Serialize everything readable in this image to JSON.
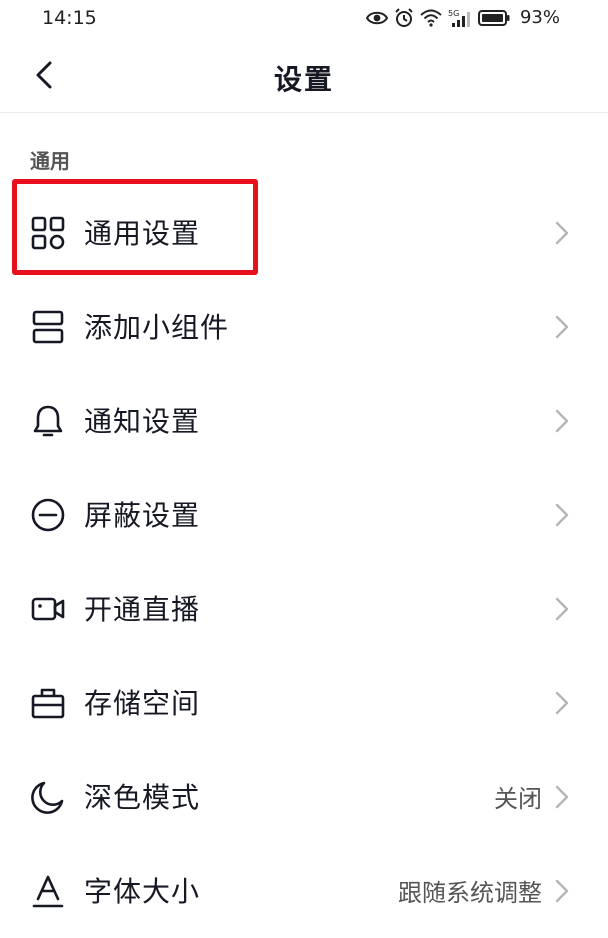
{
  "status_bar": {
    "time": "14:15",
    "battery": "93%"
  },
  "header": {
    "title": "设置"
  },
  "section": {
    "title": "通用"
  },
  "items": [
    {
      "label": "通用设置",
      "value": "",
      "icon": "grid-icon"
    },
    {
      "label": "添加小组件",
      "value": "",
      "icon": "widget-icon"
    },
    {
      "label": "通知设置",
      "value": "",
      "icon": "bell-icon"
    },
    {
      "label": "屏蔽设置",
      "value": "",
      "icon": "block-icon"
    },
    {
      "label": "开通直播",
      "value": "",
      "icon": "video-camera-icon"
    },
    {
      "label": "存储空间",
      "value": "",
      "icon": "storage-icon"
    },
    {
      "label": "深色模式",
      "value": "关闭",
      "icon": "moon-icon"
    },
    {
      "label": "字体大小",
      "value": "跟随系统调整",
      "icon": "font-size-icon"
    }
  ],
  "colors": {
    "highlight": "#e8101c",
    "text": "#161823",
    "secondary": "#555555"
  }
}
